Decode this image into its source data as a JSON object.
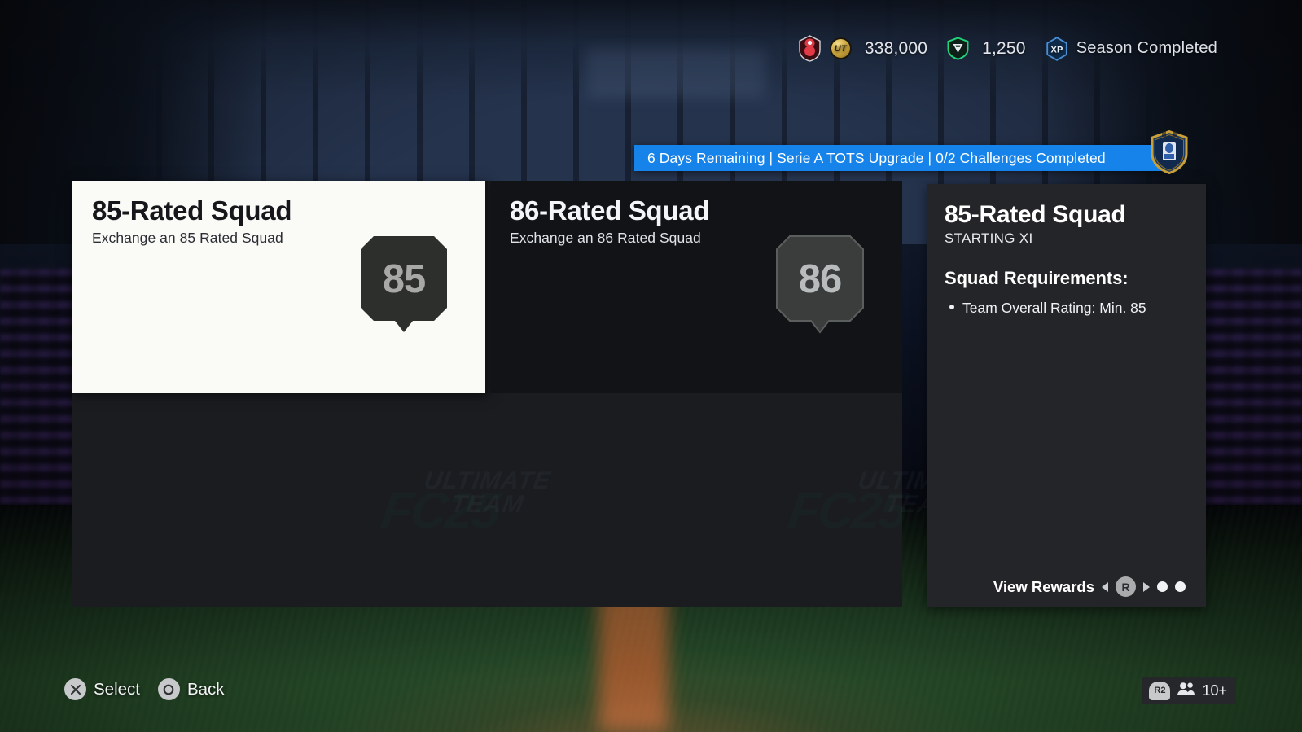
{
  "header": {
    "club_badge_icon": "club-crest-icon",
    "currency_icon": "ut-coin-icon",
    "coin_glyph": "UT",
    "coins": "338,000",
    "points_icon": "fc-points-icon",
    "points": "1,250",
    "xp_icon": "xp-icon",
    "xp_glyph": "XP",
    "season_status": "Season Completed"
  },
  "banner": {
    "text": "6 Days Remaining | Serie A TOTS Upgrade | 0/2 Challenges Completed",
    "badge_icon": "sbc-set-badge-icon",
    "accent_color": "#1583ea"
  },
  "cards": [
    {
      "title": "85-Rated Squad",
      "subtitle": "Exchange an 85 Rated Squad",
      "rating": "85",
      "selected": true
    },
    {
      "title": "86-Rated Squad",
      "subtitle": "Exchange an 86 Rated Squad",
      "rating": "86",
      "selected": false
    }
  ],
  "detail": {
    "title": "85-Rated Squad",
    "subtitle": "STARTING XI",
    "requirements_heading": "Squad Requirements:",
    "requirements": [
      "Team Overall Rating: Min. 85"
    ],
    "view_rewards_label": "View Rewards",
    "rewards_button_glyph": "R",
    "page_dots": 2
  },
  "watermarks": {
    "ultimate_team": "ULTIMATE",
    "ultimate_team2": "TEAM",
    "fc_logo": "FC25"
  },
  "bottom_bar": {
    "select_label": "Select",
    "select_icon": "ps-cross-icon",
    "back_label": "Back",
    "back_icon": "ps-circle-icon",
    "trigger_glyph": "R2",
    "friends_icon": "people-icon",
    "friends_count": "10+"
  }
}
